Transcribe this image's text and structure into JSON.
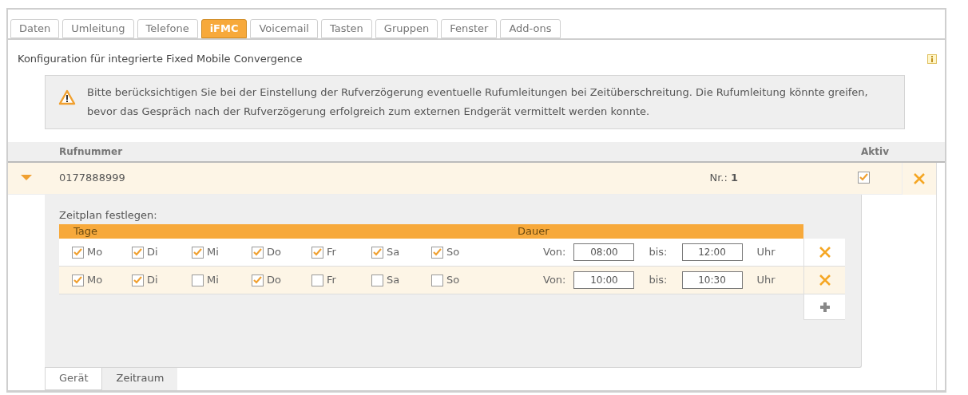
{
  "tabs": [
    {
      "label": "Daten",
      "selected": false
    },
    {
      "label": "Umleitung",
      "selected": false
    },
    {
      "label": "Telefone",
      "selected": false
    },
    {
      "label": "iFMC",
      "selected": true
    },
    {
      "label": "Voicemail",
      "selected": false
    },
    {
      "label": "Tasten",
      "selected": false
    },
    {
      "label": "Gruppen",
      "selected": false
    },
    {
      "label": "Fenster",
      "selected": false
    },
    {
      "label": "Add-ons",
      "selected": false
    }
  ],
  "heading": "Konfiguration für integrierte Fixed Mobile Convergence",
  "warning": "Bitte berücksichtigen Sie bei der Einstellung der Rufverzögerung eventuelle Rufumleitungen bei Zeitüberschreitung. Die Rufumleitung könnte greifen, bevor das Gespräch nach der Rufverzögerung erfolgreich zum externen Endgerät vermittelt werden konnte.",
  "table": {
    "columns": [
      "Rufnummer",
      "Aktiv"
    ],
    "rows": [
      {
        "number": "0177888999",
        "nr": "Nr.: **1**",
        "active": true,
        "expanded": true,
        "schedule": {
          "label": "Zeitplan festlegen:",
          "columns": [
            "Tage",
            "Dauer"
          ],
          "rows": [
            {
              "days": [
                {
                  "label": "Mo",
                  "checked": true
                },
                {
                  "label": "Di",
                  "checked": true
                },
                {
                  "label": "Mi",
                  "checked": true
                },
                {
                  "label": "Do",
                  "checked": true
                },
                {
                  "label": "Fr",
                  "checked": true
                },
                {
                  "label": "Sa",
                  "checked": true
                },
                {
                  "label": "So",
                  "checked": true
                }
              ],
              "from_label": "Von:",
              "from": "08:00",
              "to_label": "bis:",
              "to": "12:00",
              "unit": "Uhr"
            },
            {
              "days": [
                {
                  "label": "Mo",
                  "checked": true
                },
                {
                  "label": "Di",
                  "checked": true
                },
                {
                  "label": "Mi",
                  "checked": false
                },
                {
                  "label": "Do",
                  "checked": true
                },
                {
                  "label": "Fr",
                  "checked": false
                },
                {
                  "label": "Sa",
                  "checked": false
                },
                {
                  "label": "So",
                  "checked": false
                }
              ],
              "from_label": "Von:",
              "from": "10:00",
              "to_label": "bis:",
              "to": "10:30",
              "unit": "Uhr"
            }
          ]
        },
        "subtabs": [
          {
            "label": "Gerät",
            "selected": false
          },
          {
            "label": "Zeitraum",
            "selected": true
          }
        ]
      }
    ]
  }
}
